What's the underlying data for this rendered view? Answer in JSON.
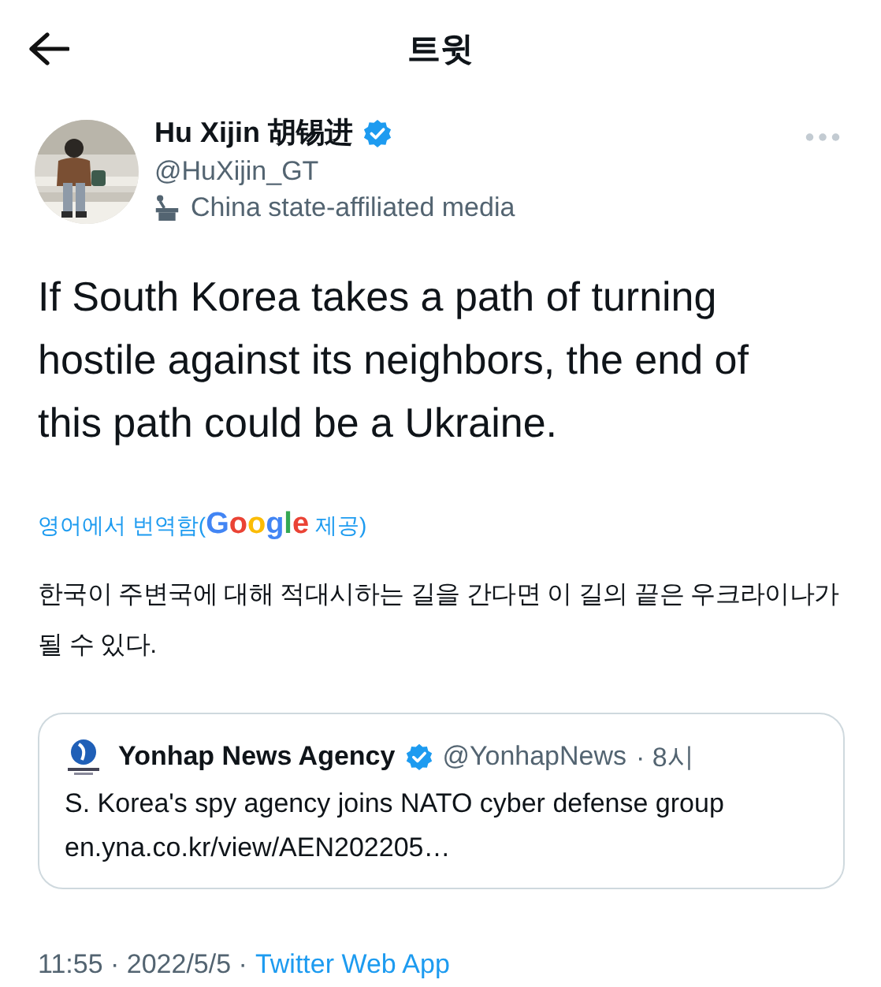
{
  "header": {
    "title": "트윗"
  },
  "author": {
    "name": "Hu Xijin 胡锡进",
    "verified": true,
    "handle": "@HuXijin_GT",
    "label": "China state-affiliated media"
  },
  "tweet": {
    "text": "If South Korea takes a path of turning hostile against its neighbors, the end of this path could be a Ukraine."
  },
  "translation": {
    "prefix": "영어에서 번역함(",
    "provider": "Google",
    "suffix": "제공)",
    "text": "한국이 주변국에 대해 적대시하는 길을 간다면 이 길의 끝은 우크라이나가 될 수 있다."
  },
  "quote": {
    "name": "Yonhap News Agency",
    "verified": true,
    "handle": "@YonhapNews",
    "time": "· 8시",
    "text": "S. Korea's spy agency joins NATO cyber defense group",
    "link": "en.yna.co.kr/view/AEN202205…"
  },
  "meta": {
    "time": "11:55 · 2022/5/5 ·",
    "source": "Twitter Web App"
  }
}
